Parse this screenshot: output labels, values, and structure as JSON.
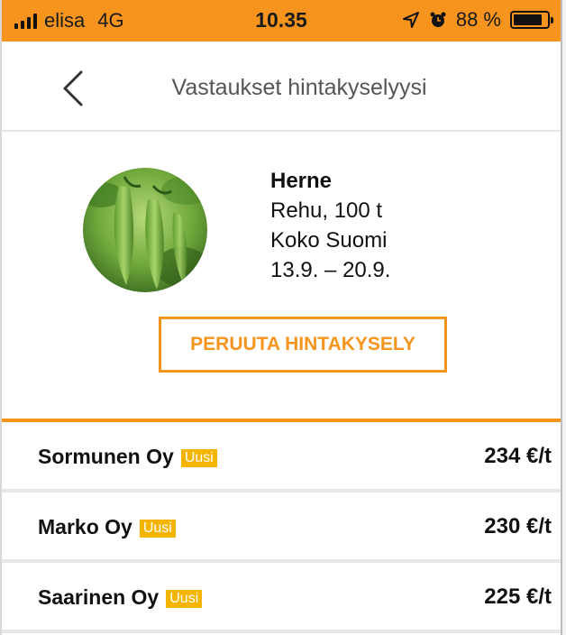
{
  "status_bar": {
    "carrier": "elisa",
    "network": "4G",
    "time": "10.35",
    "battery": "88 %",
    "battery_level": 0.88,
    "accent_color": "#f7941d"
  },
  "header": {
    "title": "Vastaukset hintakyselyysi",
    "back_icon": "chevron-left-icon"
  },
  "product": {
    "name": "Herne",
    "details": [
      "Rehu, 100 t",
      "Koko Suomi",
      "13.9. – 20.9."
    ],
    "image": "pea-pods-photo"
  },
  "actions": {
    "cancel_label": "PERUUTA HINTAKYSELY"
  },
  "offers": [
    {
      "company": "Sormunen Oy",
      "badge": "Uusi",
      "price": "234 €/t"
    },
    {
      "company": "Marko Oy",
      "badge": "Uusi",
      "price": "230 €/t"
    },
    {
      "company": "Saarinen Oy",
      "badge": "Uusi",
      "price": "225 €/t"
    }
  ],
  "colors": {
    "accent": "#f7941d",
    "badge": "#f4b400"
  }
}
